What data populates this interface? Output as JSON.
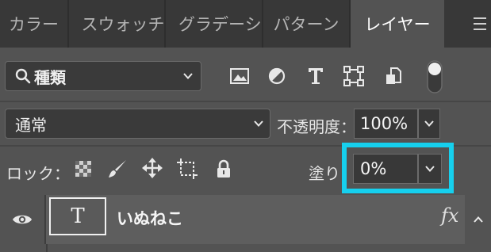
{
  "tabs": [
    {
      "label": "カラー",
      "active": false
    },
    {
      "label": "スウォッチ",
      "active": false
    },
    {
      "label": "グラデーション",
      "active": false
    },
    {
      "label": "パターン",
      "active": false
    },
    {
      "label": "レイヤー",
      "active": true
    }
  ],
  "filter": {
    "label": "種類",
    "icons": [
      "image-filter-icon",
      "adjustment-filter-icon",
      "type-filter-icon",
      "shape-filter-icon",
      "smart-object-filter-icon",
      "filter-toggle-icon"
    ]
  },
  "blend": {
    "mode": "通常",
    "opacity_label": "不透明度：",
    "opacity_value": "100%"
  },
  "lock": {
    "label": "ロック：",
    "icons": [
      "lock-transparent-pixels-icon",
      "lock-image-pixels-icon",
      "lock-position-icon",
      "lock-artboard-icon",
      "lock-all-icon"
    ]
  },
  "fill": {
    "label": "塗り：",
    "value": "0%"
  },
  "layer": {
    "name": "いぬねこ",
    "thumb_glyph": "T",
    "fx_label": "fx"
  },
  "colors": {
    "highlight": "#16d0ee",
    "panel": "#535353",
    "tabbar": "#383838"
  }
}
